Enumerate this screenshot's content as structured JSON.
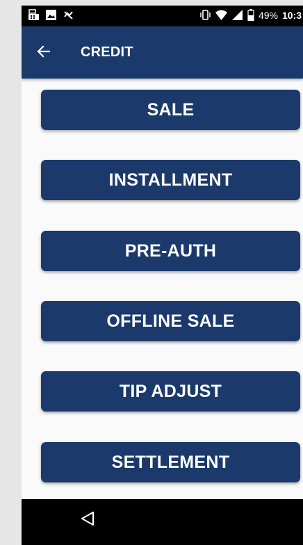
{
  "status_bar": {
    "battery_percent": "49%",
    "time": "10:3",
    "left_icons": [
      "cash-register-icon",
      "image-icon",
      "muted-icon"
    ],
    "right_icons": [
      "vibrate-icon",
      "wifi-icon",
      "signal-icon",
      "battery-icon"
    ]
  },
  "app_bar": {
    "title": "CREDIT",
    "back_icon": "arrow-left-icon",
    "color": "#1b3a6b"
  },
  "menu": {
    "items": [
      {
        "label": "SALE"
      },
      {
        "label": "INSTALLMENT"
      },
      {
        "label": "PRE-AUTH"
      },
      {
        "label": "OFFLINE SALE"
      },
      {
        "label": "TIP ADJUST"
      },
      {
        "label": "SETTLEMENT"
      }
    ],
    "button_color": "#1b3a6b",
    "text_color": "#ffffff"
  },
  "nav_bar": {
    "back_icon": "triangle-back-icon"
  }
}
